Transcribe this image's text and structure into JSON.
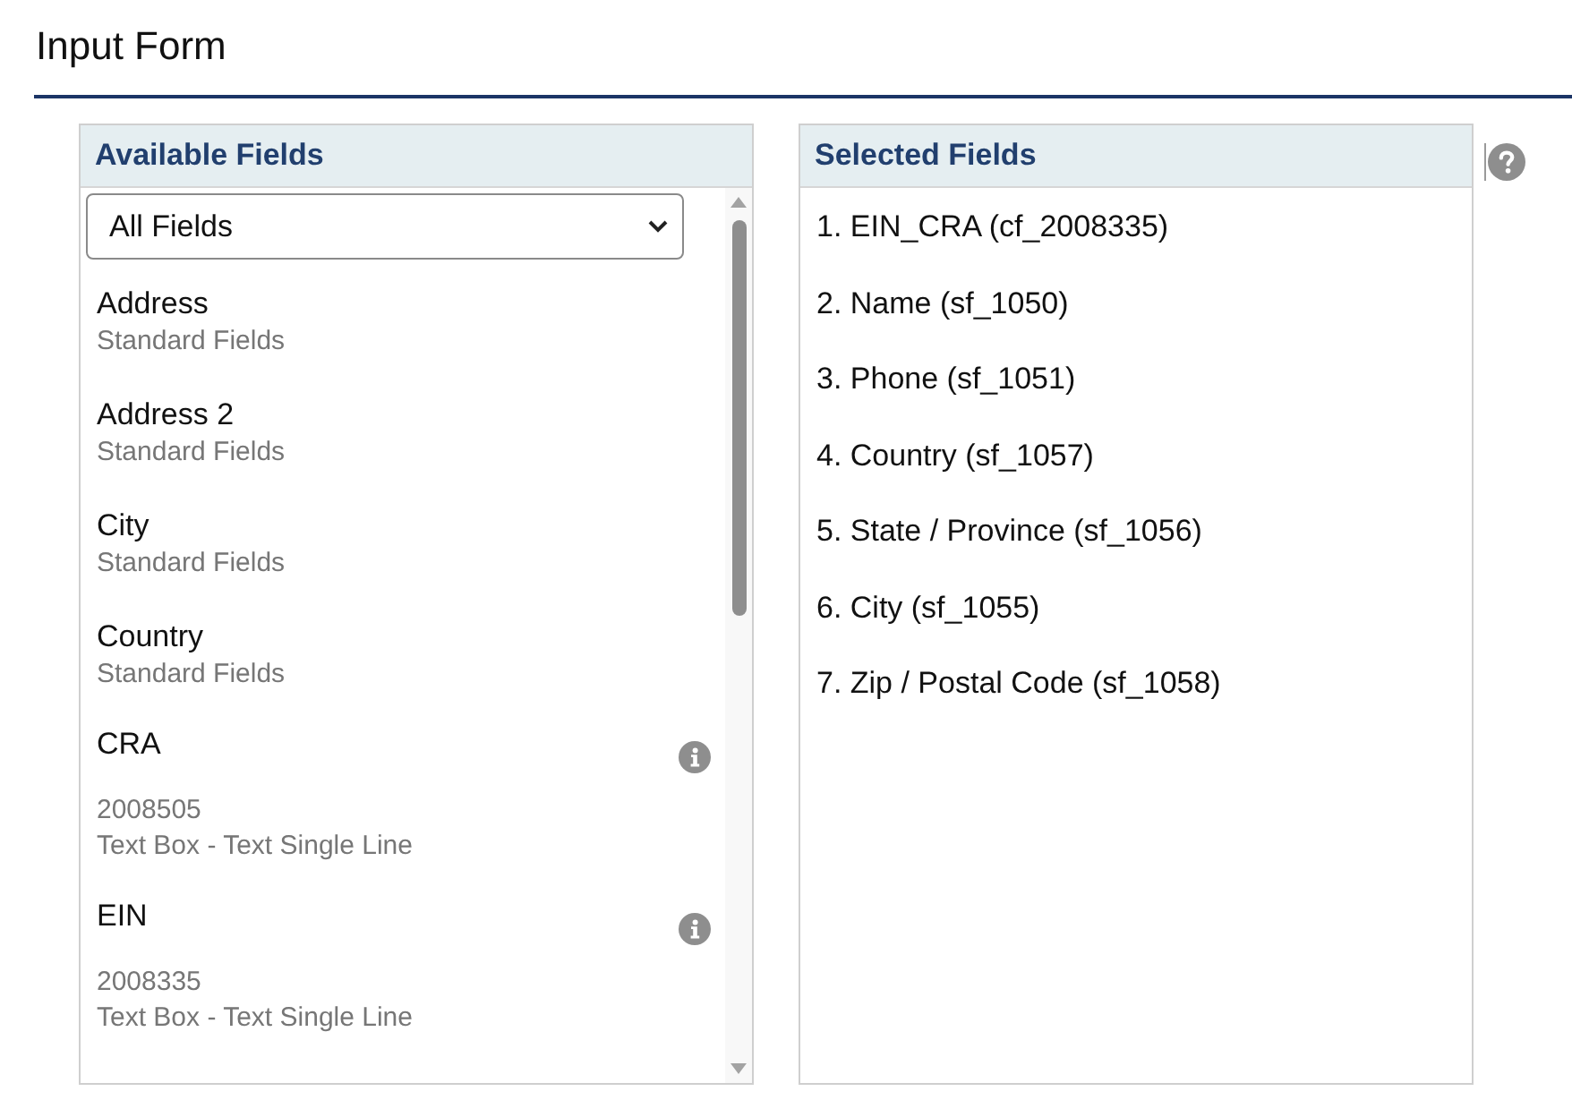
{
  "page": {
    "title": "Input Form"
  },
  "available_fields": {
    "title": "Available Fields",
    "filter": {
      "value": "All Fields"
    },
    "items": [
      {
        "kind": "standard",
        "name": "Address",
        "category": "Standard Fields"
      },
      {
        "kind": "standard",
        "name": "Address 2",
        "category": "Standard Fields"
      },
      {
        "kind": "standard",
        "name": "City",
        "category": "Standard Fields"
      },
      {
        "kind": "standard",
        "name": "Country",
        "category": "Standard Fields"
      },
      {
        "kind": "custom",
        "name": "CRA",
        "id": "2008505",
        "type": "Text Box - Text Single Line"
      },
      {
        "kind": "custom",
        "name": "EIN",
        "id": "2008335",
        "type": "Text Box - Text Single Line"
      }
    ]
  },
  "selected_fields": {
    "title": "Selected Fields",
    "items": [
      "1. EIN_CRA (cf_2008335)",
      "2. Name (sf_1050)",
      "3. Phone (sf_1051)",
      "4. Country (sf_1057)",
      "5. State / Province (sf_1056)",
      "6. City (sf_1055)",
      "7. Zip / Postal Code (sf_1058)"
    ]
  }
}
